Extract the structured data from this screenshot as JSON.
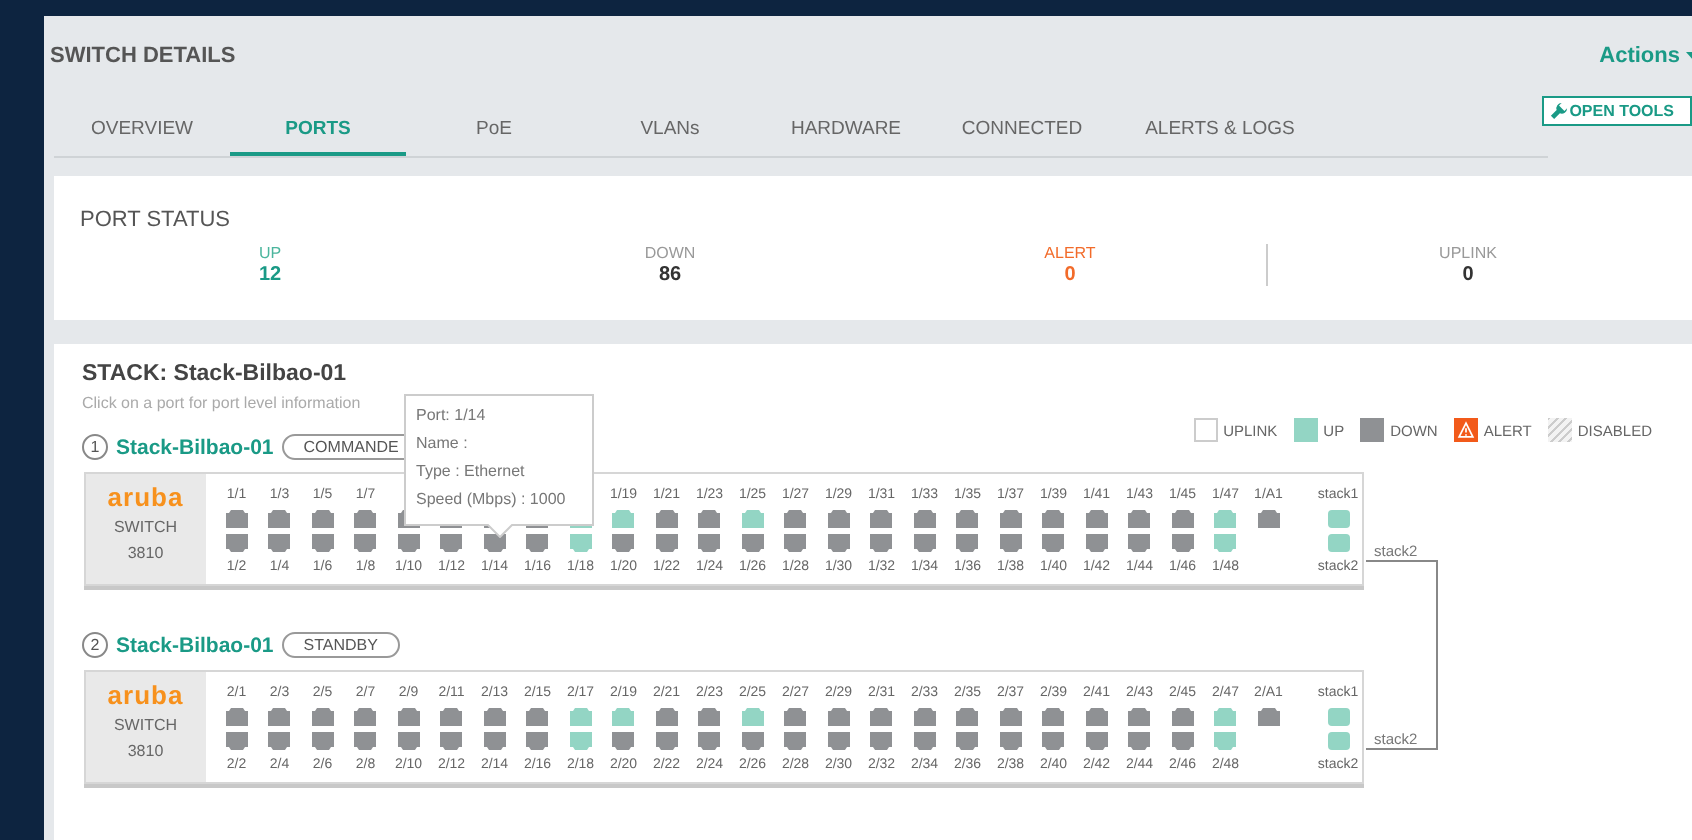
{
  "header": {
    "title": "SWITCH DETAILS",
    "actions": "Actions"
  },
  "tabs": [
    {
      "label": "OVERVIEW",
      "selected": false
    },
    {
      "label": "PORTS",
      "selected": true
    },
    {
      "label": "PoE",
      "selected": false
    },
    {
      "label": "VLANs",
      "selected": false
    },
    {
      "label": "HARDWARE",
      "selected": false
    },
    {
      "label": "CONNECTED",
      "selected": false
    },
    {
      "label": "ALERTS & LOGS",
      "selected": false
    }
  ],
  "open_tools": "OPEN TOOLS",
  "port_status": {
    "title": "PORT STATUS",
    "stats": [
      {
        "kind": "up",
        "label": "UP",
        "value": "12"
      },
      {
        "kind": "down",
        "label": "DOWN",
        "value": "86"
      },
      {
        "kind": "alert",
        "label": "ALERT",
        "value": "0"
      },
      {
        "kind": "uplink",
        "label": "UPLINK",
        "value": "0"
      }
    ]
  },
  "stack": {
    "title": "STACK: Stack-Bilbao-01",
    "hint": "Click on a port for port level information",
    "legend": [
      {
        "kind": "uplink",
        "label": "UPLINK"
      },
      {
        "kind": "up",
        "label": "UP"
      },
      {
        "kind": "down",
        "label": "DOWN"
      },
      {
        "kind": "alert",
        "label": "ALERT"
      },
      {
        "kind": "disabled",
        "label": "DISABLED"
      }
    ],
    "switches": [
      {
        "number": "1",
        "name": "Stack-Bilbao-01",
        "role": "COMMANDE",
        "brand": "aruba",
        "type": "SWITCH",
        "model": "3810",
        "top_ports": [
          {
            "label": "1/1",
            "up": false
          },
          {
            "label": "1/3",
            "up": false
          },
          {
            "label": "1/5",
            "up": false
          },
          {
            "label": "1/7",
            "up": false
          },
          {
            "up": false
          },
          {
            "up": false
          },
          {
            "up": false
          },
          {
            "up": false
          },
          {
            "up": true
          },
          {
            "label": "1/19",
            "up": true
          },
          {
            "label": "1/21",
            "up": false
          },
          {
            "label": "1/23",
            "up": false
          },
          {
            "label": "1/25",
            "up": true
          },
          {
            "label": "1/27",
            "up": false
          },
          {
            "label": "1/29",
            "up": false
          },
          {
            "label": "1/31",
            "up": false
          },
          {
            "label": "1/33",
            "up": false
          },
          {
            "label": "1/35",
            "up": false
          },
          {
            "label": "1/37",
            "up": false
          },
          {
            "label": "1/39",
            "up": false
          },
          {
            "label": "1/41",
            "up": false
          },
          {
            "label": "1/43",
            "up": false
          },
          {
            "label": "1/45",
            "up": false
          },
          {
            "label": "1/47",
            "up": true
          },
          {
            "label": "1/A1",
            "up": false
          }
        ],
        "bottom_ports": [
          {
            "label": "1/2",
            "up": false
          },
          {
            "label": "1/4",
            "up": false
          },
          {
            "label": "1/6",
            "up": false
          },
          {
            "label": "1/8",
            "up": false
          },
          {
            "label": "1/10",
            "up": false
          },
          {
            "label": "1/12",
            "up": false
          },
          {
            "label": "1/14",
            "up": false
          },
          {
            "label": "1/16",
            "up": false
          },
          {
            "label": "1/18",
            "up": true
          },
          {
            "label": "1/20",
            "up": false
          },
          {
            "label": "1/22",
            "up": false
          },
          {
            "label": "1/24",
            "up": false
          },
          {
            "label": "1/26",
            "up": false
          },
          {
            "label": "1/28",
            "up": false
          },
          {
            "label": "1/30",
            "up": false
          },
          {
            "label": "1/32",
            "up": false
          },
          {
            "label": "1/34",
            "up": false
          },
          {
            "label": "1/36",
            "up": false
          },
          {
            "label": "1/38",
            "up": false
          },
          {
            "label": "1/40",
            "up": false
          },
          {
            "label": "1/42",
            "up": false
          },
          {
            "label": "1/44",
            "up": false
          },
          {
            "label": "1/46",
            "up": false
          },
          {
            "label": "1/48",
            "up": true
          }
        ],
        "stack_ports": [
          {
            "label": "stack1",
            "up": true
          },
          {
            "label": "stack2",
            "up": true
          }
        ]
      },
      {
        "number": "2",
        "name": "Stack-Bilbao-01",
        "role": "STANDBY",
        "brand": "aruba",
        "type": "SWITCH",
        "model": "3810",
        "top_ports": [
          {
            "label": "2/1",
            "up": false
          },
          {
            "label": "2/3",
            "up": false
          },
          {
            "label": "2/5",
            "up": false
          },
          {
            "label": "2/7",
            "up": false
          },
          {
            "label": "2/9",
            "up": false
          },
          {
            "label": "2/11",
            "up": false
          },
          {
            "label": "2/13",
            "up": false
          },
          {
            "label": "2/15",
            "up": false
          },
          {
            "label": "2/17",
            "up": true
          },
          {
            "label": "2/19",
            "up": true
          },
          {
            "label": "2/21",
            "up": false
          },
          {
            "label": "2/23",
            "up": false
          },
          {
            "label": "2/25",
            "up": true
          },
          {
            "label": "2/27",
            "up": false
          },
          {
            "label": "2/29",
            "up": false
          },
          {
            "label": "2/31",
            "up": false
          },
          {
            "label": "2/33",
            "up": false
          },
          {
            "label": "2/35",
            "up": false
          },
          {
            "label": "2/37",
            "up": false
          },
          {
            "label": "2/39",
            "up": false
          },
          {
            "label": "2/41",
            "up": false
          },
          {
            "label": "2/43",
            "up": false
          },
          {
            "label": "2/45",
            "up": false
          },
          {
            "label": "2/47",
            "up": true
          },
          {
            "label": "2/A1",
            "up": false
          }
        ],
        "bottom_ports": [
          {
            "label": "2/2",
            "up": false
          },
          {
            "label": "2/4",
            "up": false
          },
          {
            "label": "2/6",
            "up": false
          },
          {
            "label": "2/8",
            "up": false
          },
          {
            "label": "2/10",
            "up": false
          },
          {
            "label": "2/12",
            "up": false
          },
          {
            "label": "2/14",
            "up": false
          },
          {
            "label": "2/16",
            "up": false
          },
          {
            "label": "2/18",
            "up": true
          },
          {
            "label": "2/20",
            "up": false
          },
          {
            "label": "2/22",
            "up": false
          },
          {
            "label": "2/24",
            "up": false
          },
          {
            "label": "2/26",
            "up": false
          },
          {
            "label": "2/28",
            "up": false
          },
          {
            "label": "2/30",
            "up": false
          },
          {
            "label": "2/32",
            "up": false
          },
          {
            "label": "2/34",
            "up": false
          },
          {
            "label": "2/36",
            "up": false
          },
          {
            "label": "2/38",
            "up": false
          },
          {
            "label": "2/40",
            "up": false
          },
          {
            "label": "2/42",
            "up": false
          },
          {
            "label": "2/44",
            "up": false
          },
          {
            "label": "2/46",
            "up": false
          },
          {
            "label": "2/48",
            "up": true
          }
        ],
        "stack_ports": [
          {
            "label": "stack1",
            "up": true
          },
          {
            "label": "stack2",
            "up": true
          }
        ]
      }
    ],
    "stack_link": {
      "labels": [
        "stack2",
        "stack2"
      ]
    },
    "tooltip": {
      "lines": [
        "Port: 1/14",
        "Name :",
        "Type : Ethernet",
        "Speed (Mbps) : 1000"
      ]
    }
  }
}
